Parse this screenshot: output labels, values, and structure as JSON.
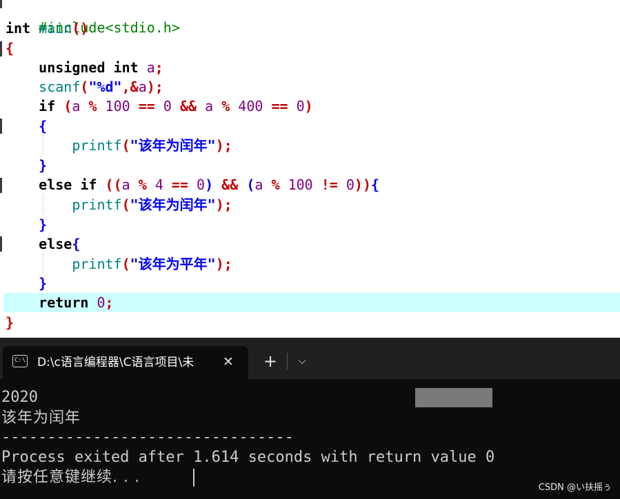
{
  "editor": {
    "lines": [
      [
        "#include<stdio.h>"
      ],
      [
        "int",
        " ",
        "main",
        "(",
        ")"
      ],
      [
        "{"
      ],
      [
        "    ",
        "unsigned",
        " ",
        "int",
        " ",
        "a",
        ";"
      ],
      [
        "    ",
        "scanf",
        "(",
        "\"%d\"",
        ",&",
        "a",
        ")",
        ";"
      ],
      [
        "    ",
        "if",
        " ",
        "(",
        "a",
        " ",
        "%",
        " ",
        "100",
        " ",
        "==",
        " ",
        "0",
        " ",
        "&&",
        " ",
        "a",
        " ",
        "%",
        " ",
        "400",
        " ",
        "==",
        " ",
        "0",
        ")"
      ],
      [
        "    ",
        "{"
      ],
      [
        "        ",
        "printf",
        "(",
        "\"该年为闰年\"",
        ")",
        ";"
      ],
      [
        "    ",
        "}"
      ],
      [
        "    ",
        "else",
        " ",
        "if",
        " ",
        "((",
        "a",
        " ",
        "%",
        " ",
        "4",
        " ",
        "==",
        " ",
        "0",
        ")",
        " ",
        "&&",
        " ",
        "(",
        "a",
        " ",
        "%",
        " ",
        "100",
        " ",
        "!=",
        " ",
        "0",
        "))",
        "{"
      ],
      [
        "        ",
        "printf",
        "(",
        "\"该年为闰年\"",
        ")",
        ";"
      ],
      [
        "    ",
        "}"
      ],
      [
        "    ",
        "else",
        "{"
      ],
      [
        "        ",
        "printf",
        "(",
        "\"该年为平年\"",
        ")",
        ";"
      ],
      [
        "    ",
        "}"
      ],
      [
        "    ",
        "return",
        " ",
        "0",
        ";"
      ],
      [
        "}"
      ]
    ]
  },
  "terminal": {
    "tab_title": "D:\\c语言编程器\\C语言项目\\未",
    "icon_glyph": "C:\\",
    "close_glyph": "✕",
    "new_tab_glyph": "+",
    "dropdown_glyph": "⌵",
    "output": {
      "line1": "2020",
      "line2": "该年为闰年",
      "line3": "--------------------------------",
      "line4": "Process exited after 1.614 seconds with return value 0",
      "line5": "请按任意键继续. . ."
    },
    "watermark": "CSDN @い扶摇ぅ"
  }
}
